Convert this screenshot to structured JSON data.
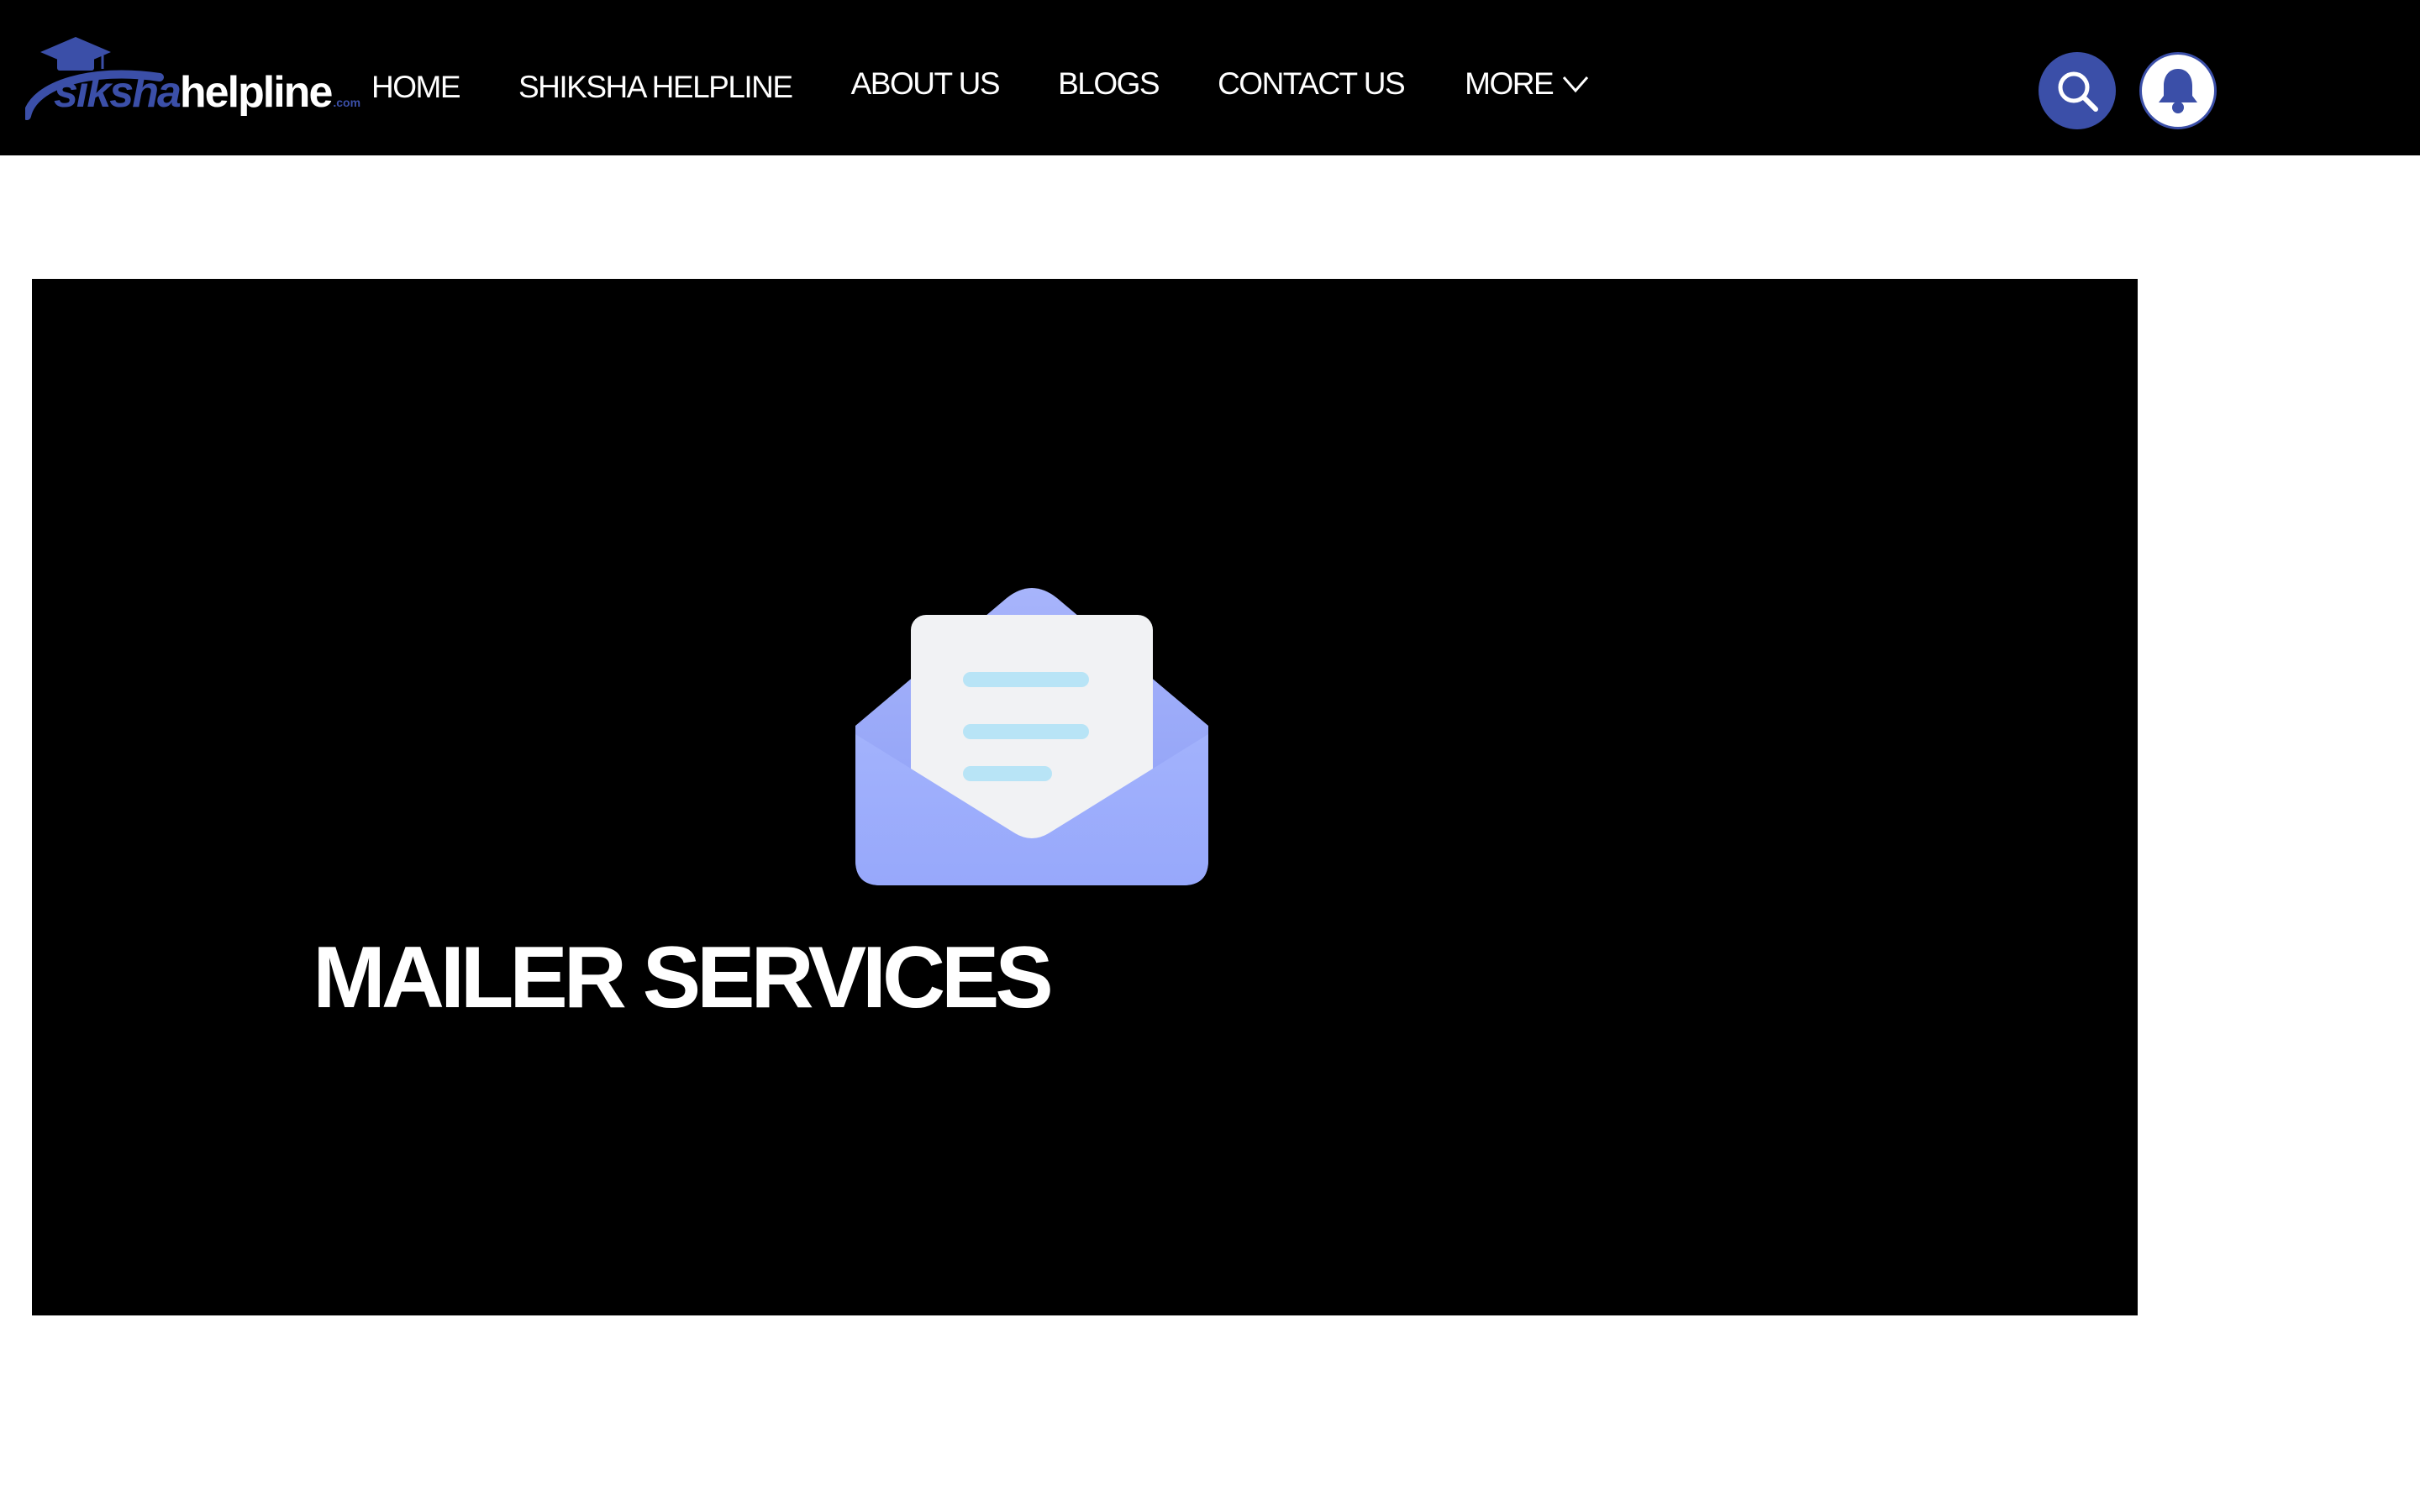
{
  "brand": {
    "logo_part1": "siksha",
    "logo_part2": "helpline",
    "logo_part3": ".com",
    "primary_color": "#3b4fa8",
    "header_bg": "#000000"
  },
  "nav": {
    "items": [
      {
        "label": "HOME"
      },
      {
        "label": "SHIKSHA HELPLINE"
      },
      {
        "label": "ABOUT US"
      },
      {
        "label": "BLOGS"
      },
      {
        "label": "CONTACT US"
      },
      {
        "label": "MORE",
        "icon": "chevron-down-icon"
      }
    ]
  },
  "actions": {
    "search_icon": "search-icon",
    "bell_icon": "bell-icon"
  },
  "hero": {
    "title": "MAILER SERVICES",
    "illustration": "open-envelope-icon",
    "envelope_color": "#9aaaf8",
    "letter_color": "#f1f2f4",
    "line_color": "#b8e4f6"
  }
}
